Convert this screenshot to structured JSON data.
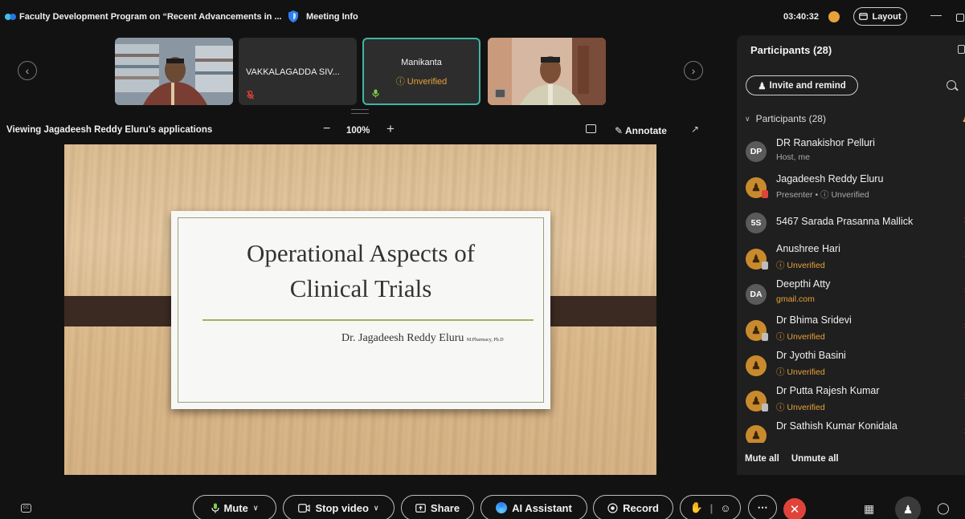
{
  "titlebar": {
    "window_title": "Faculty Development Program on “Recent Advancements in ...",
    "meeting_info": "Meeting Info",
    "clock": "03:40:32",
    "layout_label": "Layout"
  },
  "video_strip": {
    "tiles": [
      {
        "name": ""
      },
      {
        "name": "VAKKALAGADDA SIV..."
      },
      {
        "name": "Manikanta",
        "status": "Unverified"
      },
      {
        "name": ""
      }
    ]
  },
  "viewing": {
    "label": "Viewing Jagadeesh Reddy Eluru's applications",
    "zoom_minus": "−",
    "zoom_level": "100%",
    "zoom_plus": "+",
    "annotate": "Annotate"
  },
  "slide": {
    "title_line1": "Operational Aspects of",
    "title_line2": "Clinical Trials",
    "author": "Dr. Jagadeesh Reddy Eluru",
    "credentials": "M.Pharmacy, Ph.D"
  },
  "participants_panel": {
    "title": "Participants (28)",
    "invite_label": "Invite and remind",
    "section_label": "Participants (28)",
    "people": [
      {
        "initials": "DP",
        "name": "DR Ranakishor Pelluri",
        "sub": "Host, me",
        "sub_style": "grey"
      },
      {
        "initials": "",
        "name": "Jagadeesh Reddy Eluru",
        "sub": "Presenter • ⓘ Unverified",
        "sub_style": "amber"
      },
      {
        "initials": "5S",
        "name": "5467 Sarada Prasanna Mallick",
        "sub": "",
        "sub_style": "grey"
      },
      {
        "initials": "",
        "name": "Anushree Hari",
        "sub": "ⓘ Unverified",
        "sub_style": "amber"
      },
      {
        "initials": "DA",
        "name": "Deepthi Atty",
        "sub": "gmail.com",
        "sub_style": "amber"
      },
      {
        "initials": "",
        "name": "Dr Bhima Sridevi",
        "sub": "ⓘ Unverified",
        "sub_style": "amber"
      },
      {
        "initials": "",
        "name": "Dr Jyothi Basini",
        "sub": "ⓘ Unverified",
        "sub_style": "amber"
      },
      {
        "initials": "",
        "name": "Dr Putta Rajesh Kumar",
        "sub": "ⓘ Unverified",
        "sub_style": "amber"
      },
      {
        "initials": "",
        "name": "Dr Sathish Kumar Konidala",
        "sub": "",
        "sub_style": "amber"
      }
    ],
    "mute_all": "Mute all",
    "unmute_all": "Unmute all"
  },
  "toolbar": {
    "mute": "Mute",
    "stop_video": "Stop video",
    "share": "Share",
    "ai_assistant": "AI Assistant",
    "record": "Record"
  },
  "colors": {
    "accent_amber": "#e8a23a",
    "end_red": "#e0433a",
    "active_tile_border": "#3fb6a4"
  }
}
